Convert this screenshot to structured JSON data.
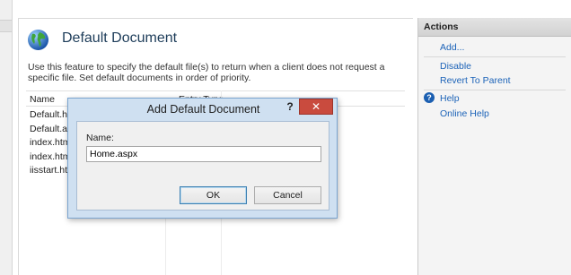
{
  "feature": {
    "title": "Default Document",
    "description": "Use this feature to specify the default file(s) to return when a client does not request a specific file. Set default documents in order of priority.",
    "columns": {
      "name": "Name",
      "entry_type": "Entry Type"
    },
    "files": [
      "Default.htm",
      "Default.asp",
      "index.htm",
      "index.html",
      "iisstart.htm"
    ]
  },
  "actions": {
    "header": "Actions",
    "add": "Add...",
    "disable": "Disable",
    "revert": "Revert To Parent",
    "help": "Help",
    "online_help": "Online Help"
  },
  "dialog": {
    "title": "Add Default Document",
    "help_glyph": "?",
    "close_glyph": "✕",
    "name_label": "Name:",
    "name_value": "Home.aspx",
    "ok_label": "OK",
    "cancel_label": "Cancel"
  },
  "colors": {
    "link": "#1c63b8",
    "close_button": "#c94b3e",
    "dialog_frame": "#cfe0f1"
  },
  "icons": [
    "globe-icon",
    "help-icon",
    "close-icon"
  ]
}
